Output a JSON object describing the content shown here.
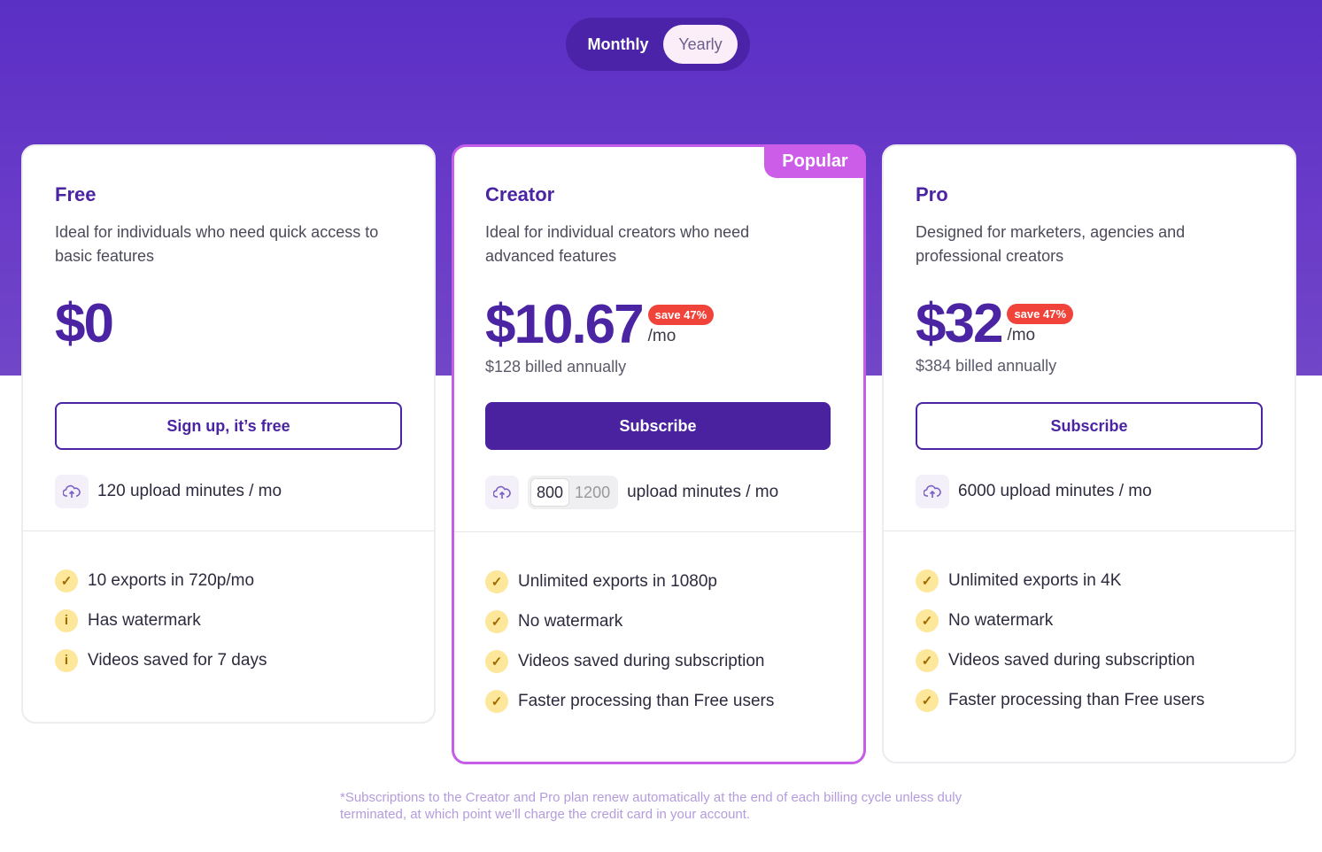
{
  "billing_toggle": {
    "monthly_label": "Monthly",
    "yearly_label": "Yearly",
    "selected": "Yearly"
  },
  "plans": [
    {
      "name": "Free",
      "description": "Ideal for individuals who need quick access to basic features",
      "price": "$0",
      "cta_label": "Sign up, it’s free",
      "upload_minutes": "120 upload minutes / mo",
      "features": [
        {
          "text": "10 exports in 720p/mo",
          "icon": "check-icon"
        },
        {
          "text": "Has watermark",
          "icon": "info-icon"
        },
        {
          "text": "Videos saved for 7 days",
          "icon": "info-icon"
        }
      ]
    },
    {
      "name": "Creator",
      "badge": "Popular",
      "description": "Ideal for individual creators who need advanced features",
      "price": "$10.67",
      "save_badge": "save 47%",
      "per_period": "/mo",
      "billed": "$128 billed annually",
      "cta_label": "Subscribe",
      "minutes_options": [
        "800",
        "1200"
      ],
      "minutes_selected": "800",
      "upload_minutes_suffix": "upload minutes / mo",
      "features": [
        {
          "text": "Unlimited exports in 1080p",
          "icon": "check-icon"
        },
        {
          "text": "No watermark",
          "icon": "check-icon"
        },
        {
          "text": "Videos saved during subscription",
          "icon": "check-icon"
        },
        {
          "text": "Faster processing than Free users",
          "icon": "check-icon"
        }
      ]
    },
    {
      "name": "Pro",
      "description": "Designed for marketers, agencies and professional creators",
      "price": "$32",
      "save_badge": "save 47%",
      "per_period": "/mo",
      "billed": "$384 billed annually",
      "cta_label": "Subscribe",
      "upload_minutes": "6000 upload minutes / mo",
      "features": [
        {
          "text": "Unlimited exports in 4K",
          "icon": "check-icon"
        },
        {
          "text": "No watermark",
          "icon": "check-icon"
        },
        {
          "text": "Videos saved during subscription",
          "icon": "check-icon"
        },
        {
          "text": "Faster processing than Free users",
          "icon": "check-icon"
        }
      ]
    }
  ],
  "footnote": "*Subscriptions to the Creator and Pro plan renew automatically at the end of each billing cycle unless duly terminated, at which point we'll charge the credit card in your account.",
  "colors": {
    "brand_purple": "#4b24a3",
    "hero_purple": "#5a2fc4",
    "popular_pink": "#cc5de8",
    "save_red": "#f0443a",
    "feature_icon_yellow": "#fde79a"
  }
}
